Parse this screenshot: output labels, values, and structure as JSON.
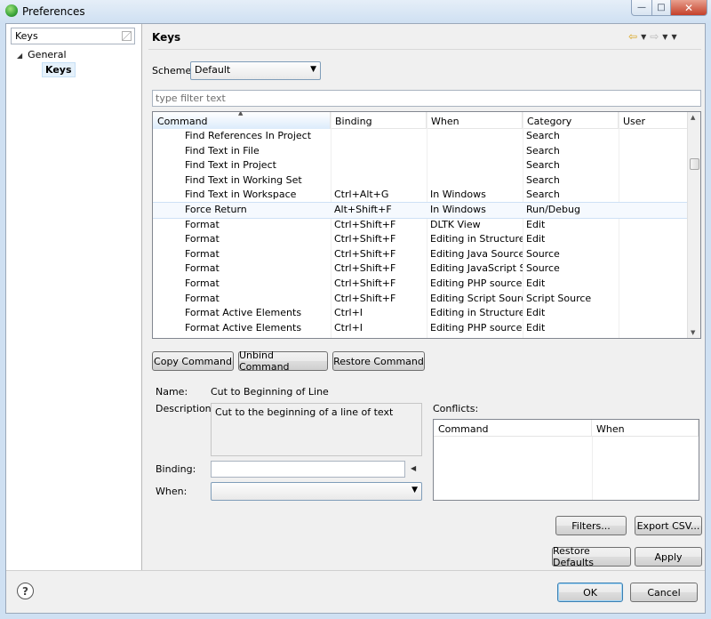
{
  "window": {
    "title": "Preferences"
  },
  "window_controls": {
    "minimize": "—",
    "maximize": "□",
    "close": "✕"
  },
  "left_panel": {
    "filter_value": "Keys",
    "tree": {
      "parent": "General",
      "child": "Keys"
    }
  },
  "page": {
    "title": "Keys"
  },
  "scheme": {
    "label": "Scheme:",
    "value": "Default"
  },
  "type_filter": {
    "placeholder": "type filter text"
  },
  "commands_table": {
    "columns": [
      "Command",
      "Binding",
      "When",
      "Category",
      "User"
    ],
    "rows": [
      {
        "command": "Find References In Project",
        "binding": "",
        "when": "",
        "category": "Search"
      },
      {
        "command": "Find Text in File",
        "binding": "",
        "when": "",
        "category": "Search"
      },
      {
        "command": "Find Text in Project",
        "binding": "",
        "when": "",
        "category": "Search"
      },
      {
        "command": "Find Text in Working Set",
        "binding": "",
        "when": "",
        "category": "Search"
      },
      {
        "command": "Find Text in Workspace",
        "binding": "Ctrl+Alt+G",
        "when": "In Windows",
        "category": "Search"
      },
      {
        "command": "Force Return",
        "binding": "Alt+Shift+F",
        "when": "In Windows",
        "category": "Run/Debug"
      },
      {
        "command": "Format",
        "binding": "Ctrl+Shift+F",
        "when": "DLTK View",
        "category": "Edit"
      },
      {
        "command": "Format",
        "binding": "Ctrl+Shift+F",
        "when": "Editing in Structure...",
        "category": "Edit"
      },
      {
        "command": "Format",
        "binding": "Ctrl+Shift+F",
        "when": "Editing Java Source",
        "category": "Source"
      },
      {
        "command": "Format",
        "binding": "Ctrl+Shift+F",
        "when": "Editing JavaScript S...",
        "category": "Source"
      },
      {
        "command": "Format",
        "binding": "Ctrl+Shift+F",
        "when": "Editing PHP source",
        "category": "Edit"
      },
      {
        "command": "Format",
        "binding": "Ctrl+Shift+F",
        "when": "Editing Script Source",
        "category": "Script Source"
      },
      {
        "command": "Format Active Elements",
        "binding": "Ctrl+I",
        "when": "Editing in Structure...",
        "category": "Edit"
      },
      {
        "command": "Format Active Elements",
        "binding": "Ctrl+I",
        "when": "Editing PHP source",
        "category": "Edit"
      }
    ]
  },
  "buttons": {
    "copy_command": "Copy Command",
    "unbind_command": "Unbind Command",
    "restore_command": "Restore Command",
    "filters": "Filters...",
    "export_csv": "Export CSV...",
    "restore_defaults": "Restore Defaults",
    "apply": "Apply",
    "ok": "OK",
    "cancel": "Cancel"
  },
  "details": {
    "name_label": "Name:",
    "name_value": "Cut to Beginning of Line",
    "description_label": "Description:",
    "description_value": "Cut to the beginning of a line of text",
    "binding_label": "Binding:",
    "binding_value": "",
    "when_label": "When:",
    "when_value": ""
  },
  "conflicts": {
    "label": "Conflicts:",
    "columns": [
      "Command",
      "When"
    ]
  },
  "help": {
    "glyph": "?"
  }
}
